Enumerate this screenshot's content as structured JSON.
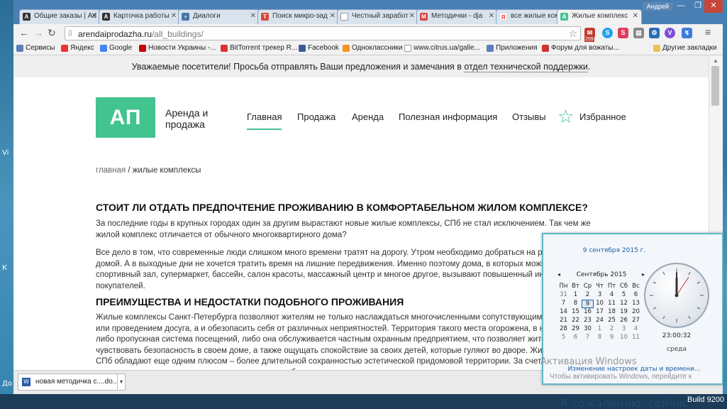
{
  "desktop": {
    "strip_labels": [
      "Vi",
      "К",
      "До"
    ]
  },
  "browser": {
    "user": "Андрей",
    "tabs": [
      {
        "title": "Общие заказы | Ad",
        "icon": "A"
      },
      {
        "title": "Карточка работы",
        "icon": "A"
      },
      {
        "title": "Диалоги",
        "icon": "D"
      },
      {
        "title": "Поиск микро-зад",
        "icon": "T"
      },
      {
        "title": "Честный заработ",
        "icon": "page"
      },
      {
        "title": "Методички - dja",
        "icon": "M"
      },
      {
        "title": "все жилые комп",
        "icon": "Y"
      },
      {
        "title": "Жилые комплекс",
        "icon": "AH"
      }
    ],
    "url_domain": "arendaiprodazha.ru",
    "url_path": "/all_buildings/",
    "bookmarks": [
      "Сервисы",
      "Яндекс",
      "Google",
      "Новости Украины -...",
      "BitTorrent трекер R...",
      "Facebook",
      "Одноклассники",
      "www.citrus.ua/galle...",
      "Приложения",
      "Форум для вожаты...",
      "Другие закладки"
    ],
    "ext_badge": "259"
  },
  "page": {
    "notice": "Уважаемые посетители! Просьба отправлять Ваши предложения и замечания в",
    "notice_link": "отдел технической поддержки",
    "notice_end": ".",
    "logo_text": "АП",
    "brand": "Аренда и продажа",
    "nav": [
      "Главная",
      "Продажа",
      "Аренда",
      "Полезная информация",
      "Отзывы",
      "Избранное"
    ],
    "breadcrumb_home": "главная",
    "breadcrumb_sep": " / ",
    "breadcrumb_current": "жилые комплексы",
    "h1": "СТОИТ ЛИ ОТДАТЬ ПРЕДПОЧТЕНИЕ ПРОЖИВАНИЮ В КОМФОРТАБЕЛЬНОМ ЖИЛОМ КОМПЛЕКСЕ?",
    "p1": "За последние годы в крупных городах один за другим вырастают новые жилые комплексы, СПб не стал исключением. Так чем же жилой комплекс отличается от обычного многоквартирного дома?",
    "p2": "Все дело в том, что современные люди слишком много времени тратят на дорогу. Утром необходимо добраться на работу, вечером - домой. А в выходные дни не хочется тратить время на лишние передвижения. Именно поэтому дома, в которых можно посетить спортивный зал, супермаркет, бассейн, салон красоты, массажный центр и многое другое, вызывают повышенный интерес у покупателей.",
    "h2": "ПРЕИМУЩЕСТВА И НЕДОСТАТКИ ПОДОБНОГО ПРОЖИВАНИЯ",
    "p3": "Жилые комплексы Санкт-Петербурга позволяют жителям не только наслаждаться многочисленными сопутствующими процедурами или проведением досуга, а и обезопасить себя от различных неприятностей. Территория такого места огорожена, в ней работает либо пропускная система посещений, либо она обслуживается частным охранным предприятием, что позволяет жителям комплекса чувствовать безопасность в своем доме, а также ощущать спокойствие за своих детей, которые гуляют во дворе. Жилые комплексы СПб обладают еще одним плюсом – более длительной сохранностью эстетической придомовой территории. За счет ограниченного круга лиц, которые могут пользоваться дворовыми благами"
  },
  "downloads": {
    "file": "новая методичка с....do..."
  },
  "calendar": {
    "full_date": "9 сентября 2015 г.",
    "month": "Сентябрь 2015",
    "weekdays": [
      "Пн",
      "Вт",
      "Ср",
      "Чт",
      "Пт",
      "Сб",
      "Вс"
    ],
    "weeks": [
      [
        "31",
        "1",
        "2",
        "3",
        "4",
        "5",
        "6"
      ],
      [
        "7",
        "8",
        "9",
        "10",
        "11",
        "12",
        "13"
      ],
      [
        "14",
        "15",
        "16",
        "17",
        "18",
        "19",
        "20"
      ],
      [
        "21",
        "22",
        "23",
        "24",
        "25",
        "26",
        "27"
      ],
      [
        "28",
        "29",
        "30",
        "1",
        "2",
        "3",
        "4"
      ],
      [
        "5",
        "6",
        "7",
        "8",
        "9",
        "10",
        "11"
      ]
    ],
    "today": "9",
    "time": "23:00:32",
    "day": "среда",
    "link": "Изменение настроек даты и времени..."
  },
  "watermark": {
    "line1": "Активация Windows",
    "line2": "Чтобы активировать Windows, перейдите к"
  },
  "taskbar": {
    "sorry": "К сожалению, сейчас",
    "build": "Build 9200"
  },
  "colors": {
    "accent": "#43c390",
    "tabstrip": "#4a7fb3",
    "calendar_border": "#5fb7c7"
  }
}
